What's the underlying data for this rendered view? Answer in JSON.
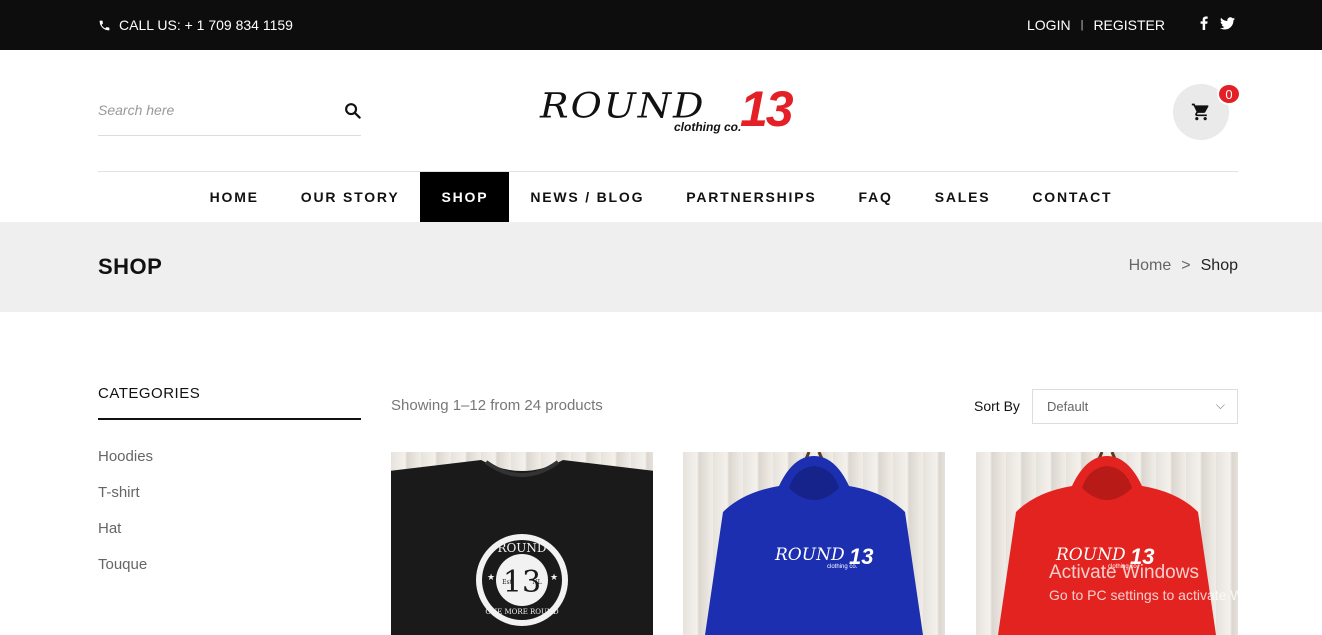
{
  "topbar": {
    "call_text": "CALL US: + 1 709 834 1159",
    "login": "LOGIN",
    "separator": "|",
    "register": "REGISTER",
    "icons": [
      "phone-icon",
      "facebook-icon",
      "twitter-icon"
    ]
  },
  "search": {
    "placeholder": "Search here"
  },
  "logo": {
    "word": "ROUND",
    "number": "13",
    "subtitle": "clothing co."
  },
  "cart": {
    "count": "0"
  },
  "nav": {
    "items": [
      {
        "label": "HOME"
      },
      {
        "label": "OUR STORY"
      },
      {
        "label": "SHOP",
        "active": true
      },
      {
        "label": "NEWS / BLOG"
      },
      {
        "label": "PARTNERSHIPS"
      },
      {
        "label": "FAQ"
      },
      {
        "label": "SALES"
      },
      {
        "label": "CONTACT"
      }
    ]
  },
  "page_header": {
    "title": "SHOP",
    "breadcrumb": {
      "home": "Home",
      "sep": ">",
      "current": "Shop"
    }
  },
  "sidebar": {
    "title": "CATEGORIES",
    "items": [
      "Hoodies",
      "T-shirt",
      "Hat",
      "Touque"
    ]
  },
  "toolbar": {
    "showing": "Showing 1–12 from 24 products",
    "sort_label": "Sort By",
    "sort_value": "Default"
  },
  "products": [
    {
      "garment": "t-shirt",
      "color": "#1a1a1a",
      "print_word": "ROUND",
      "print_number": "13",
      "print_small_left": "Est",
      "print_small_right": "NL",
      "print_tagline": "ONE MORE ROUND"
    },
    {
      "garment": "hoodie",
      "color": "#1c2fb0",
      "print_word": "ROUND",
      "print_number": "13",
      "print_sub": "clothing co."
    },
    {
      "garment": "hoodie",
      "color": "#e3231f",
      "print_word": "ROUND",
      "print_number": "13",
      "print_sub": "clothing co."
    }
  ],
  "watermark": {
    "line1": "Activate Windows",
    "line2": "Go to PC settings to activate Windows."
  },
  "colors": {
    "topbar": "#0d0d0d",
    "accent": "#e41f26",
    "page_header_bg": "#efefef"
  }
}
